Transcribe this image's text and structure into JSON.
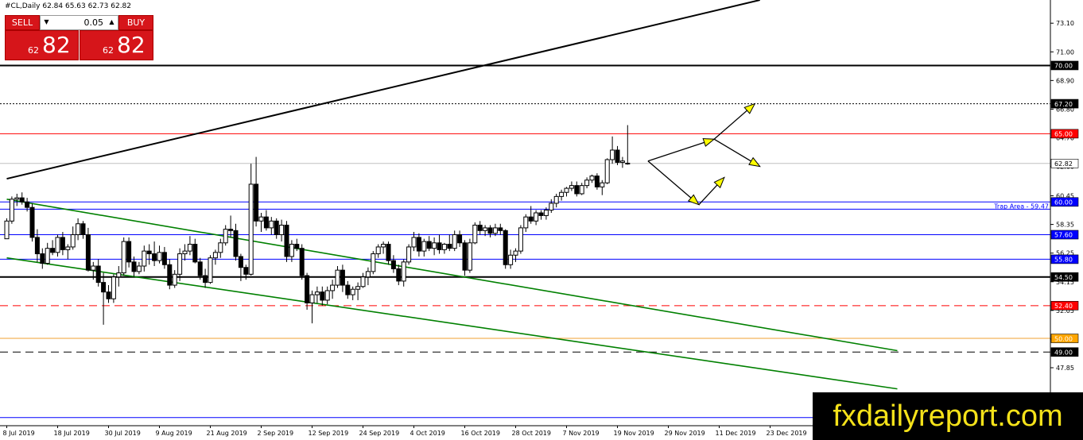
{
  "header": {
    "symbol": "#CL,Daily",
    "ohlc": "62.84 65.63 62.73 62.82"
  },
  "trade_panel": {
    "sell_label": "SELL",
    "buy_label": "BUY",
    "lot_value": "0.05",
    "sell_price_small": "62",
    "sell_price_big": "82",
    "buy_price_small": "62",
    "buy_price_big": "82"
  },
  "watermark": "fxdailyreport.com",
  "colors": {
    "bull_body": "#ffffff",
    "bear_body": "#000000",
    "resistance_red": "#ff0000",
    "support_blue": "#0000ff",
    "channel_green": "#008000",
    "arrow_yellow": "#ffff00",
    "label_blue_bg": "#0000ff",
    "label_red_bg": "#ff0000",
    "label_orange_bg": "#ffa500"
  },
  "chart_data": {
    "type": "candlestick",
    "y_axis_side": "right",
    "ylim": [
      43.6,
      74.8
    ],
    "y_ticks": [
      "73.10",
      "71.00",
      "68.90",
      "66.80",
      "64.70",
      "62.60",
      "60.45",
      "58.35",
      "56.25",
      "54.15",
      "52.05",
      "49.95",
      "47.85",
      "45.75"
    ],
    "x_labels": [
      "8 Jul 2019",
      "18 Jul 2019",
      "30 Jul 2019",
      "9 Aug 2019",
      "21 Aug 2019",
      "2 Sep 2019",
      "12 Sep 2019",
      "24 Sep 2019",
      "4 Oct 2019",
      "16 Oct 2019",
      "28 Oct 2019",
      "7 Nov 2019",
      "19 Nov 2019",
      "29 Nov 2019",
      "11 Dec 2019",
      "23 Dec 2019"
    ],
    "level_labels": [
      {
        "value": 70.0,
        "text": "70.00",
        "style": "black"
      },
      {
        "value": 67.2,
        "text": "67.20",
        "style": "black"
      },
      {
        "value": 65.0,
        "text": "65.00",
        "style": "red"
      },
      {
        "value": 62.82,
        "text": "62.82",
        "style": "white"
      },
      {
        "value": 60.0,
        "text": "60.00",
        "style": "blue"
      },
      {
        "value": 57.6,
        "text": "57.60",
        "style": "blue"
      },
      {
        "value": 55.8,
        "text": "55.80",
        "style": "blue"
      },
      {
        "value": 54.5,
        "text": "54.50",
        "style": "black"
      },
      {
        "value": 52.4,
        "text": "52.40",
        "style": "red"
      },
      {
        "value": 50.0,
        "text": "50.00",
        "style": "orange"
      },
      {
        "value": 49.0,
        "text": "49.00",
        "style": "black"
      }
    ],
    "annotation": {
      "text": "Trap Area - 59.47",
      "value": 59.47
    },
    "candles": [
      [
        57.3,
        58.8,
        57.3,
        58.6
      ],
      [
        58.6,
        60.4,
        58.4,
        60.2
      ],
      [
        60.2,
        60.6,
        59.7,
        60.3
      ],
      [
        60.3,
        60.7,
        59.8,
        60.0
      ],
      [
        60.0,
        60.3,
        59.3,
        59.6
      ],
      [
        59.6,
        59.9,
        57.1,
        57.4
      ],
      [
        57.4,
        58.0,
        55.6,
        56.2
      ],
      [
        56.2,
        56.6,
        55.1,
        55.5
      ],
      [
        55.5,
        57.0,
        55.4,
        56.6
      ],
      [
        56.6,
        57.2,
        56.1,
        56.3
      ],
      [
        56.3,
        57.6,
        56.0,
        57.4
      ],
      [
        57.4,
        57.8,
        56.1,
        56.5
      ],
      [
        56.5,
        56.9,
        55.8,
        56.7
      ],
      [
        56.7,
        58.2,
        56.5,
        57.6
      ],
      [
        57.6,
        58.8,
        57.2,
        58.4
      ],
      [
        58.4,
        58.6,
        57.3,
        57.6
      ],
      [
        57.6,
        58.1,
        54.9,
        55.0
      ],
      [
        55.0,
        55.6,
        54.3,
        55.3
      ],
      [
        55.3,
        55.8,
        53.8,
        54.1
      ],
      [
        54.1,
        54.8,
        51.0,
        53.4
      ],
      [
        53.4,
        53.9,
        52.6,
        52.9
      ],
      [
        52.9,
        54.7,
        52.6,
        54.5
      ],
      [
        54.5,
        55.3,
        53.8,
        54.8
      ],
      [
        54.8,
        57.4,
        54.6,
        57.1
      ],
      [
        57.1,
        57.4,
        55.2,
        55.6
      ],
      [
        55.6,
        56.0,
        54.5,
        54.9
      ],
      [
        54.9,
        55.6,
        54.7,
        55.3
      ],
      [
        55.3,
        56.8,
        54.9,
        56.4
      ],
      [
        56.4,
        56.9,
        55.4,
        56.2
      ],
      [
        56.2,
        57.1,
        55.3,
        55.7
      ],
      [
        55.7,
        56.8,
        55.5,
        56.3
      ],
      [
        56.3,
        56.7,
        55.1,
        55.4
      ],
      [
        55.4,
        55.8,
        53.6,
        53.9
      ],
      [
        53.9,
        55.0,
        53.7,
        54.7
      ],
      [
        54.7,
        56.6,
        54.2,
        56.2
      ],
      [
        56.2,
        56.9,
        55.7,
        56.4
      ],
      [
        56.4,
        57.5,
        56.1,
        56.9
      ],
      [
        56.9,
        57.3,
        55.5,
        55.6
      ],
      [
        55.6,
        55.9,
        54.3,
        54.6
      ],
      [
        54.6,
        55.1,
        53.7,
        54.1
      ],
      [
        54.1,
        56.1,
        54.0,
        55.9
      ],
      [
        55.9,
        56.5,
        55.4,
        56.3
      ],
      [
        56.3,
        57.3,
        55.9,
        57.0
      ],
      [
        57.0,
        58.3,
        56.8,
        58.0
      ],
      [
        58.0,
        59.0,
        57.4,
        57.9
      ],
      [
        57.9,
        58.4,
        55.7,
        56.0
      ],
      [
        56.0,
        56.2,
        54.2,
        55.2
      ],
      [
        55.2,
        55.4,
        54.3,
        54.7
      ],
      [
        54.7,
        62.8,
        54.6,
        61.3
      ],
      [
        61.3,
        63.3,
        58.2,
        58.6
      ],
      [
        58.6,
        59.2,
        57.8,
        58.9
      ],
      [
        58.9,
        59.4,
        57.9,
        58.1
      ],
      [
        58.1,
        58.9,
        57.6,
        58.6
      ],
      [
        58.6,
        58.8,
        57.3,
        57.6
      ],
      [
        57.6,
        58.7,
        57.1,
        58.3
      ],
      [
        58.3,
        58.6,
        55.6,
        56.0
      ],
      [
        56.0,
        57.2,
        55.6,
        56.9
      ],
      [
        56.9,
        57.3,
        56.4,
        56.6
      ],
      [
        56.6,
        56.9,
        54.3,
        54.6
      ],
      [
        54.6,
        54.8,
        52.1,
        52.6
      ],
      [
        52.6,
        53.5,
        51.1,
        53.2
      ],
      [
        53.2,
        53.8,
        52.6,
        53.4
      ],
      [
        53.4,
        53.8,
        52.4,
        52.8
      ],
      [
        52.8,
        53.8,
        52.5,
        53.5
      ],
      [
        53.5,
        54.3,
        52.9,
        53.9
      ],
      [
        53.9,
        55.3,
        53.7,
        55.0
      ],
      [
        55.0,
        55.4,
        53.4,
        53.9
      ],
      [
        53.9,
        54.2,
        52.9,
        53.2
      ],
      [
        53.2,
        53.8,
        52.8,
        53.6
      ],
      [
        53.6,
        54.1,
        52.8,
        53.8
      ],
      [
        53.8,
        54.8,
        53.7,
        54.5
      ],
      [
        54.5,
        55.2,
        53.9,
        54.9
      ],
      [
        54.9,
        56.4,
        54.7,
        56.2
      ],
      [
        56.2,
        56.9,
        55.9,
        56.7
      ],
      [
        56.7,
        57.1,
        56.2,
        56.9
      ],
      [
        56.9,
        57.1,
        55.4,
        55.7
      ],
      [
        55.7,
        56.1,
        54.8,
        55.1
      ],
      [
        55.1,
        55.4,
        53.9,
        54.2
      ],
      [
        54.2,
        55.8,
        53.8,
        55.6
      ],
      [
        55.6,
        56.9,
        55.4,
        56.7
      ],
      [
        56.7,
        57.8,
        56.4,
        57.4
      ],
      [
        57.4,
        57.7,
        56.0,
        56.4
      ],
      [
        56.4,
        57.3,
        56.0,
        57.1
      ],
      [
        57.1,
        57.5,
        56.4,
        56.6
      ],
      [
        56.6,
        57.4,
        56.1,
        57.0
      ],
      [
        57.0,
        57.6,
        56.2,
        56.5
      ],
      [
        56.5,
        57.0,
        56.2,
        56.9
      ],
      [
        56.9,
        57.6,
        56.4,
        56.6
      ],
      [
        56.6,
        57.9,
        56.4,
        57.6
      ],
      [
        57.6,
        57.9,
        56.7,
        57.0
      ],
      [
        57.0,
        57.2,
        54.6,
        55.0
      ],
      [
        55.0,
        57.3,
        54.8,
        57.0
      ],
      [
        57.0,
        58.5,
        56.9,
        58.3
      ],
      [
        58.3,
        58.6,
        57.6,
        57.9
      ],
      [
        57.9,
        58.3,
        57.5,
        58.1
      ],
      [
        58.1,
        58.3,
        57.4,
        57.7
      ],
      [
        57.7,
        58.4,
        57.5,
        58.1
      ],
      [
        58.1,
        58.4,
        57.6,
        57.9
      ],
      [
        57.9,
        58.0,
        55.1,
        55.4
      ],
      [
        55.4,
        56.5,
        55.1,
        56.1
      ],
      [
        56.1,
        56.6,
        55.6,
        56.4
      ],
      [
        56.4,
        58.3,
        56.2,
        58.1
      ],
      [
        58.1,
        59.1,
        57.8,
        58.9
      ],
      [
        58.9,
        59.7,
        58.4,
        58.6
      ],
      [
        58.6,
        59.4,
        58.3,
        59.2
      ],
      [
        59.2,
        59.4,
        58.7,
        59.0
      ],
      [
        59.0,
        59.6,
        58.7,
        59.4
      ],
      [
        59.4,
        60.2,
        59.2,
        59.9
      ],
      [
        59.9,
        60.6,
        59.6,
        60.4
      ],
      [
        60.4,
        60.9,
        60.1,
        60.7
      ],
      [
        60.7,
        61.1,
        60.4,
        61.0
      ],
      [
        61.0,
        61.5,
        60.8,
        61.2
      ],
      [
        61.2,
        61.5,
        60.4,
        60.6
      ],
      [
        60.6,
        61.4,
        60.5,
        61.2
      ],
      [
        61.2,
        61.8,
        61.0,
        61.6
      ],
      [
        61.6,
        62.0,
        61.4,
        61.9
      ],
      [
        61.9,
        62.1,
        60.9,
        61.1
      ],
      [
        61.1,
        61.6,
        60.5,
        61.4
      ],
      [
        61.4,
        63.2,
        61.3,
        63.1
      ],
      [
        63.1,
        64.8,
        62.8,
        63.8
      ],
      [
        63.8,
        64.1,
        62.7,
        62.9
      ],
      [
        62.9,
        63.3,
        62.5,
        63.0
      ],
      [
        62.84,
        65.63,
        62.73,
        62.82
      ]
    ],
    "trendlines": [
      {
        "name": "black-rising",
        "from": [
          0,
          61.7
        ],
        "to": [
          148,
          74.8
        ],
        "style": "black-thick"
      },
      {
        "name": "channel-upper",
        "from": [
          0,
          60.2
        ],
        "to": [
          175,
          49.1
        ],
        "style": "green"
      },
      {
        "name": "channel-lower",
        "from": [
          0,
          55.9
        ],
        "to": [
          175,
          46.3
        ],
        "style": "green"
      }
    ],
    "horizontal_levels": [
      {
        "value": 70.0,
        "style": "solid-black-thick"
      },
      {
        "value": 67.2,
        "style": "dotted-black"
      },
      {
        "value": 65.0,
        "style": "solid-red"
      },
      {
        "value": 62.82,
        "style": "solid-gray"
      },
      {
        "value": 60.0,
        "style": "solid-blue"
      },
      {
        "value": 59.47,
        "style": "solid-blue"
      },
      {
        "value": 57.6,
        "style": "solid-blue"
      },
      {
        "value": 55.8,
        "style": "solid-blue"
      },
      {
        "value": 54.5,
        "style": "solid-black-thick"
      },
      {
        "value": 52.4,
        "style": "dashed-red"
      },
      {
        "value": 50.0,
        "style": "solid-orange"
      },
      {
        "value": 49.0,
        "style": "dashed-black"
      },
      {
        "value": 44.2,
        "style": "solid-blue"
      }
    ],
    "projection_arrows": [
      {
        "points": [
          [
            126,
            63.0
          ],
          [
            139,
            64.6
          ],
          [
            147,
            67.2
          ]
        ]
      },
      {
        "points": [
          [
            139,
            64.6
          ],
          [
            148,
            62.6
          ]
        ]
      },
      {
        "points": [
          [
            126,
            63.0
          ],
          [
            136,
            59.8
          ],
          [
            141,
            61.8
          ]
        ]
      }
    ]
  }
}
